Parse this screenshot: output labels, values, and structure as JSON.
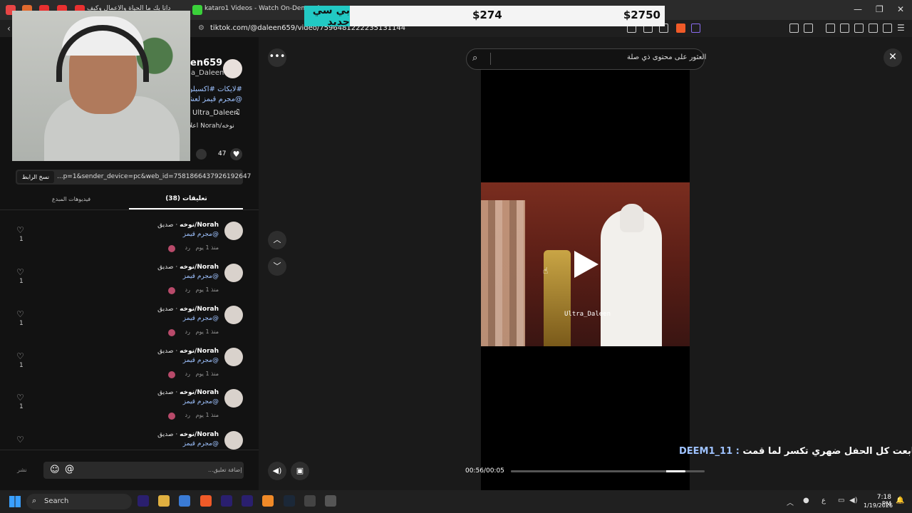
{
  "browser": {
    "tabs": [
      {
        "label": "داتا بك ما الحياة والأعمال وكيف"
      },
      {
        "label": "kataro1 Videos - Watch On-Demand"
      }
    ],
    "url": "tiktok.com/@daleen659/video/7596481222235131144",
    "window_controls": [
      "—",
      "❐",
      "✕"
    ]
  },
  "banner": {
    "new_label": "بي سي جديد",
    "price_small": "$274",
    "price_large": "$2750"
  },
  "post": {
    "author_name": "en659",
    "author_handle": "a_Daleen",
    "hashtags_line1": "#لايكات #اكسبلور",
    "hashtags_line2": "@مجرم قيمز لعشاقه",
    "music": "Ultra_Daleen",
    "collab": "نوخه/Norah اعلا",
    "likes": "47",
    "link": "...p=1&sender_device=pc&web_id=7581866437926192647",
    "copy_link_label": "نسخ الرابط"
  },
  "tabs": {
    "creator_videos": "فيديوهات المبدع",
    "comments": "(38) تعليقات"
  },
  "comments": [
    {
      "name": "Norah/نوخه",
      "relation": "· صديق",
      "text": "@مجرم قيمز",
      "time": "منذ 1 يوم",
      "reply": "رد",
      "likes": "1"
    },
    {
      "name": "Norah/نوخه",
      "relation": "· صديق",
      "text": "@مجرم قيمز",
      "time": "منذ 1 يوم",
      "reply": "رد",
      "likes": "1"
    },
    {
      "name": "Norah/نوخه",
      "relation": "· صديق",
      "text": "@مجرم قيمز",
      "time": "منذ 1 يوم",
      "reply": "رد",
      "likes": "1"
    },
    {
      "name": "Norah/نوخه",
      "relation": "· صديق",
      "text": "@مجرم قيمز",
      "time": "منذ 1 يوم",
      "reply": "رد",
      "likes": "1"
    },
    {
      "name": "Norah/نوخه",
      "relation": "· صديق",
      "text": "@مجرم قيمز",
      "time": "منذ 1 يوم",
      "reply": "رد",
      "likes": "1"
    },
    {
      "name": "Norah/نوخه",
      "relation": "· صديق",
      "text": "@مجرم قيمز",
      "time": "",
      "reply": "",
      "likes": ""
    }
  ],
  "comment_bar": {
    "post_label": "نشر",
    "placeholder": "إضافة تعليق..."
  },
  "player": {
    "search_placeholder": "العثور على محتوى ذي صلة",
    "watermark": "Ultra_Daleen",
    "caption_user": "DEEM1_11 :",
    "caption_text": "تابعت كل الحفل ضهري تكسر لما قمت",
    "time": "00:56/00:05",
    "progress": 0.9
  },
  "taskbar": {
    "search_label": "Search",
    "clock_time": "7:18 PM",
    "clock_date": "1/19/2026",
    "lang": "ع"
  },
  "colors": {
    "accent_link": "#9ec2ff",
    "banner_tag": "#22c9c4"
  }
}
